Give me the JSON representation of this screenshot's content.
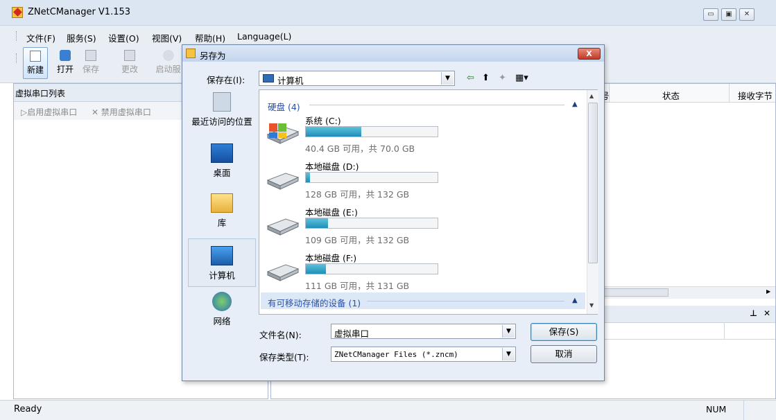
{
  "app": {
    "title": "ZNetCManager V1.153",
    "window_buttons": [
      "minimize-icon",
      "maximize-icon",
      "close-icon"
    ]
  },
  "menu": [
    "文件(F)",
    "服务(S)",
    "设置(O)",
    "视图(V)",
    "帮助(H)",
    "Language(L)"
  ],
  "toolbar": {
    "new": "新建",
    "open": "打开",
    "save": "保存",
    "change": "更改",
    "start": "启动服"
  },
  "left_panel": {
    "title": "虚拟串口列表",
    "enable": "启用虚拟串口",
    "disable": "禁用虚拟串口"
  },
  "right_panel": {
    "columns": [
      "号",
      "状态",
      "接收字节"
    ],
    "dock_icons": [
      "pin-icon",
      "close-icon"
    ]
  },
  "statusbar": {
    "left": "Ready",
    "right": "NUM"
  },
  "dialog": {
    "title": "另存为",
    "close_label": "X",
    "save_in_label": "保存在(I):",
    "save_in_value": "计算机",
    "places": [
      "最近访问的位置",
      "桌面",
      "库",
      "计算机",
      "网络"
    ],
    "selected_place": "计算机",
    "groups": {
      "hard_disks": "硬盘 (4)",
      "removable": "有可移动存储的设备 (1)"
    },
    "drives": [
      {
        "name": "系统 (C:)",
        "free": "40.4 GB 可用，共 70.0 GB",
        "used_fraction": 0.42
      },
      {
        "name": "本地磁盘 (D:)",
        "free": "128 GB 可用，共 132 GB",
        "used_fraction": 0.03
      },
      {
        "name": "本地磁盘 (E:)",
        "free": "109 GB 可用，共 132 GB",
        "used_fraction": 0.17
      },
      {
        "name": "本地磁盘 (F:)",
        "free": "111 GB 可用，共 131 GB",
        "used_fraction": 0.15
      }
    ],
    "filename_label": "文件名(N):",
    "filename_value": "虚拟串口",
    "filetype_label": "保存类型(T):",
    "filetype_value": "ZNetCManager Files (*.zncm)",
    "save_button": "保存(S)",
    "cancel_button": "取消"
  },
  "colors": {
    "drive_fill": "#1e8fb8",
    "group_header": "#2b50a8",
    "chrome": "#e9eef5"
  }
}
